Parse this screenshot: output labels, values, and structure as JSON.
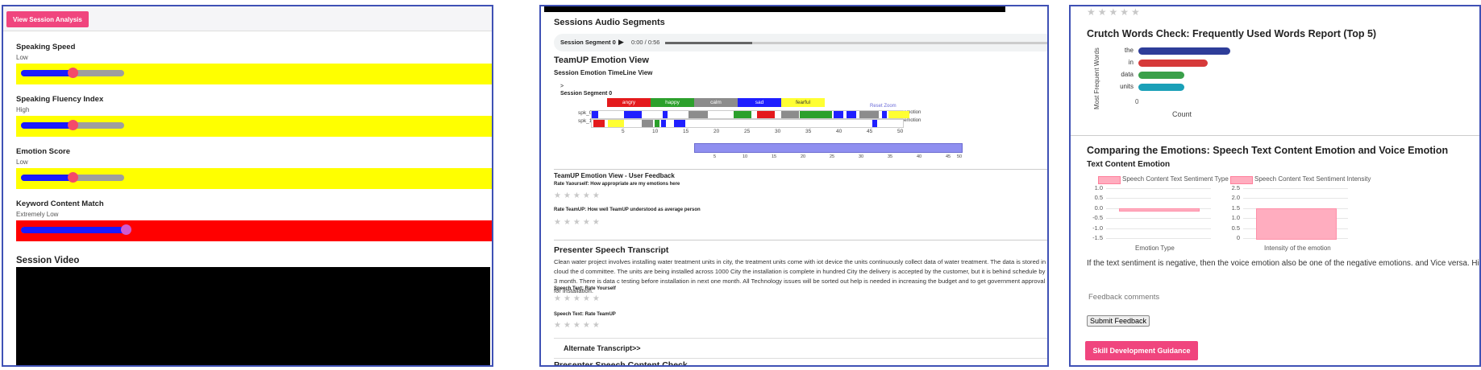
{
  "panel1": {
    "view_button": "View Session Analysis",
    "metrics": [
      {
        "title": "Speaking Speed",
        "level": "Low",
        "value": 0.5,
        "color": "#ffff00"
      },
      {
        "title": "Speaking Fluency Index",
        "level": "High",
        "value": 0.5,
        "color": "#ffff00"
      },
      {
        "title": "Emotion Score",
        "level": "Low",
        "value": 0.5,
        "color": "#ffff00"
      },
      {
        "title": "Keyword Content Match",
        "level": "Extremely Low",
        "value": 1.0,
        "color": "#ff0000"
      }
    ],
    "video_title": "Session Video"
  },
  "panel2": {
    "audio_title": "Sessions Audio Segments",
    "audio_label": "Session Segment 0",
    "audio_time": "0:00 / 0:56",
    "emotion_view_title": "TeamUP Emotion View",
    "timeline_title": "Session Emotion TimeLine View",
    "caret": ">",
    "segment_label": "Session Segment 0",
    "legend": [
      {
        "label": "angry",
        "color": "#e41a1c"
      },
      {
        "label": "happy",
        "color": "#2ca02c"
      },
      {
        "label": "calm",
        "color": "#8c8c8c"
      },
      {
        "label": "sad",
        "color": "#1f1fff"
      },
      {
        "label": "fearful",
        "color": "#ffff33"
      }
    ],
    "reset_zoom": "Reset Zoom",
    "rows": [
      {
        "label": "spk_0",
        "tag": "emotion"
      },
      {
        "label": "spk_1",
        "tag": "emotion"
      }
    ],
    "axis_ticks": [
      "5",
      "10",
      "15",
      "20",
      "25",
      "30",
      "35",
      "40",
      "45",
      "50"
    ],
    "overview_ticks": [
      "5",
      "10",
      "15",
      "20",
      "25",
      "30",
      "35",
      "40",
      "45",
      "50"
    ],
    "feedback_title": "TeamUP Emotion View - User Feedback",
    "rate_yourself": "Rate Yaourself: How appropriate are my emotions here",
    "rate_teamup": "Rate TeamUP: How well TeamUP understood as average person",
    "transcript_title": "Presenter Speech Transcript",
    "transcript": "Clean water project involves installing water treatment units in city, the treatment units come with iot device the units continuously collect data of water treatment. The data is stored in cloud the d committee. The units are being installed across 1000 City the installation is complete in hundred City the delivery is accepted by the customer, but it is behind schedule by 3 month. There is data c testing before installation in next one month. All Technology issues will be sorted out help is needed in increasing the budget and to get government approval for installation.",
    "speech_rate_yourself": "Speech Text: Rate Yourself",
    "speech_rate_teamup": "Speech Text: Rate TeamUP",
    "alt_transcript": "Alternate Transcript>>",
    "content_check": "Presenter Speech Content Check",
    "stars": "★★★★★"
  },
  "panel3": {
    "stars": "★★★★★",
    "crutch_title": "Crutch Words Check: Frequently Used Words Report (Top 5)",
    "emotion_compare_title": "Comparing the Emotions: Speech Text Content Emotion and Voice Emotion",
    "text_content_emotion": "Text Content Emotion",
    "note": "If the text sentiment is negative, then the voice emotion also be one of the negative emotions. and Vice versa. High intc",
    "feedback_placeholder": "Feedback comments",
    "submit": "Submit Feedback",
    "skill_button": "Skill Development Guidance"
  },
  "chart_data": [
    {
      "type": "bar",
      "orientation": "horizontal",
      "title": "",
      "categories": [
        "the",
        "in",
        "data",
        "units"
      ],
      "values": [
        0.88,
        0.66,
        0.44,
        0.44
      ],
      "colors": [
        "#2e3d99",
        "#d63a3a",
        "#3aa04a",
        "#1aa0b8"
      ],
      "xlabel": "Count",
      "ylabel": "Most Frequent Words",
      "x_ticks": [
        "0"
      ]
    },
    {
      "type": "bar",
      "series": [
        {
          "name": "Speech Content Text Sentiment Type",
          "values": [
            -0.1
          ]
        }
      ],
      "categories": [
        "Emotion Type"
      ],
      "ylim": [
        -1.5,
        1.0
      ],
      "y_ticks": [
        "1.0",
        "0.5",
        "0.0",
        "-0.5",
        "-1.0",
        "-1.5"
      ]
    },
    {
      "type": "bar",
      "series": [
        {
          "name": "Speech Content Text Sentiment Intensity",
          "values": [
            1.5
          ]
        }
      ],
      "categories": [
        "Intensity of the emotion"
      ],
      "ylim": [
        0,
        2.5
      ],
      "y_ticks": [
        "2.5",
        "2.0",
        "1.5",
        "1.0",
        "0.5",
        "0"
      ]
    }
  ]
}
